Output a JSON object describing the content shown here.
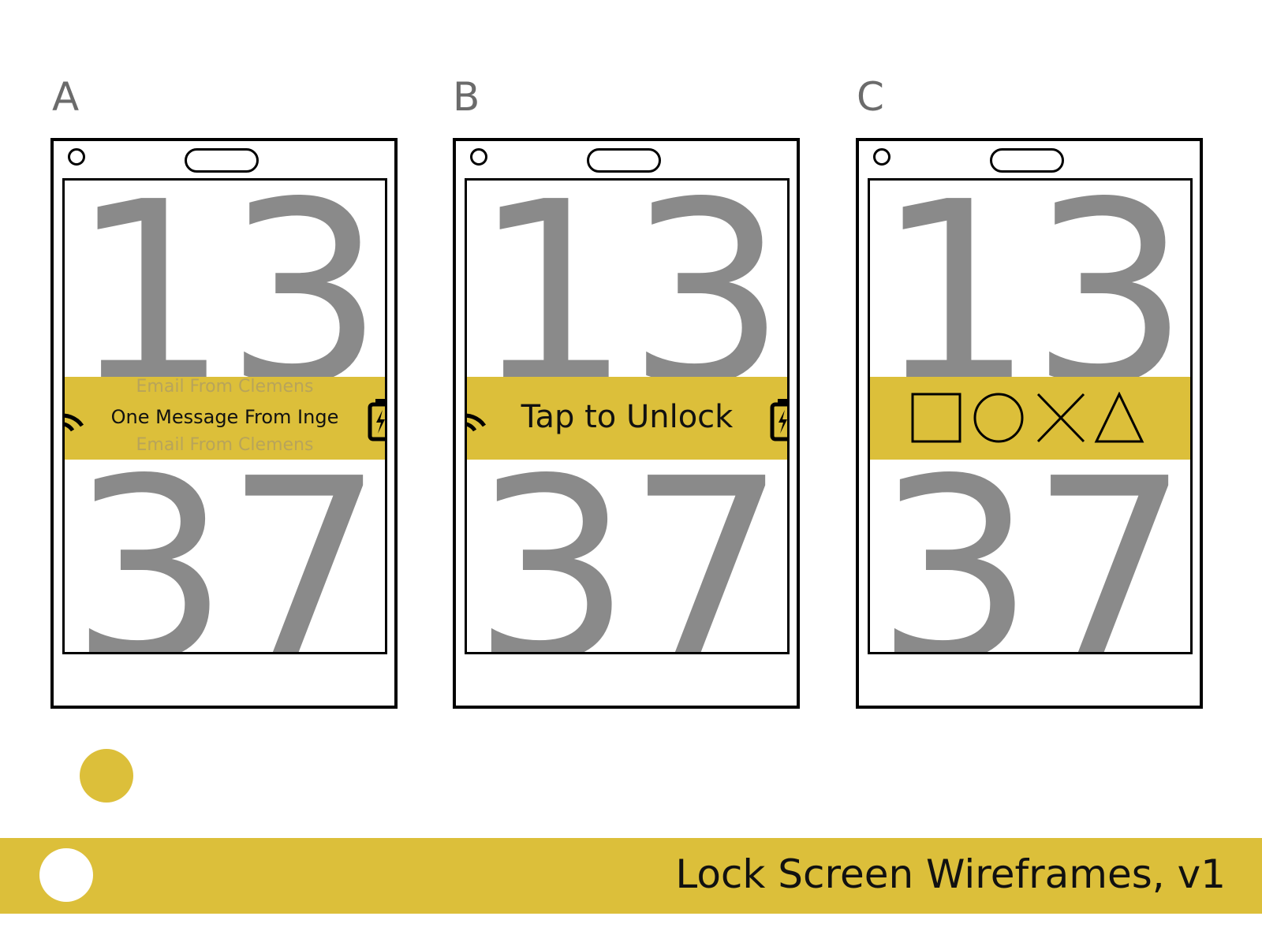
{
  "accent_color": "#dcbf3a",
  "digit_color": "#8a8a8a",
  "clock": {
    "hours": "13",
    "minutes": "37"
  },
  "wireframes": {
    "a": {
      "label": "A",
      "notifications": [
        "Email From Clemens",
        "One Message From Inge",
        "Email From Clemens"
      ]
    },
    "b": {
      "label": "B",
      "unlock_text": "Tap to Unlock"
    },
    "c": {
      "label": "C",
      "pattern_symbols": [
        "square-icon",
        "circle-icon",
        "cross-icon",
        "triangle-icon"
      ]
    }
  },
  "status_icons": [
    "wifi-icon",
    "battery-charging-icon"
  ],
  "footer": {
    "title": "Lock Screen Wireframes, v1"
  }
}
